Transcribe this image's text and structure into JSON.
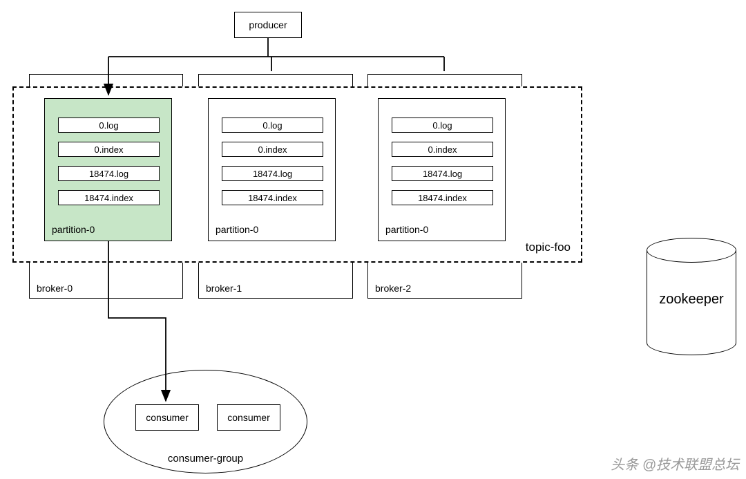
{
  "producer": {
    "label": "producer"
  },
  "topic": {
    "label": "topic-foo"
  },
  "brokers": [
    {
      "label": "broker-0"
    },
    {
      "label": "broker-1"
    },
    {
      "label": "broker-2"
    }
  ],
  "partitions": [
    {
      "label": "partition-0",
      "files": [
        "0.log",
        "0.index",
        "18474.log",
        "18474.index"
      ]
    },
    {
      "label": "partition-0",
      "files": [
        "0.log",
        "0.index",
        "18474.log",
        "18474.index"
      ]
    },
    {
      "label": "partition-0",
      "files": [
        "0.log",
        "0.index",
        "18474.log",
        "18474.index"
      ]
    }
  ],
  "consumer_group": {
    "label": "consumer-group",
    "consumers": [
      "consumer",
      "consumer"
    ]
  },
  "zookeeper": {
    "label": "zookeeper"
  },
  "watermark": "头条 @技术联盟总坛"
}
